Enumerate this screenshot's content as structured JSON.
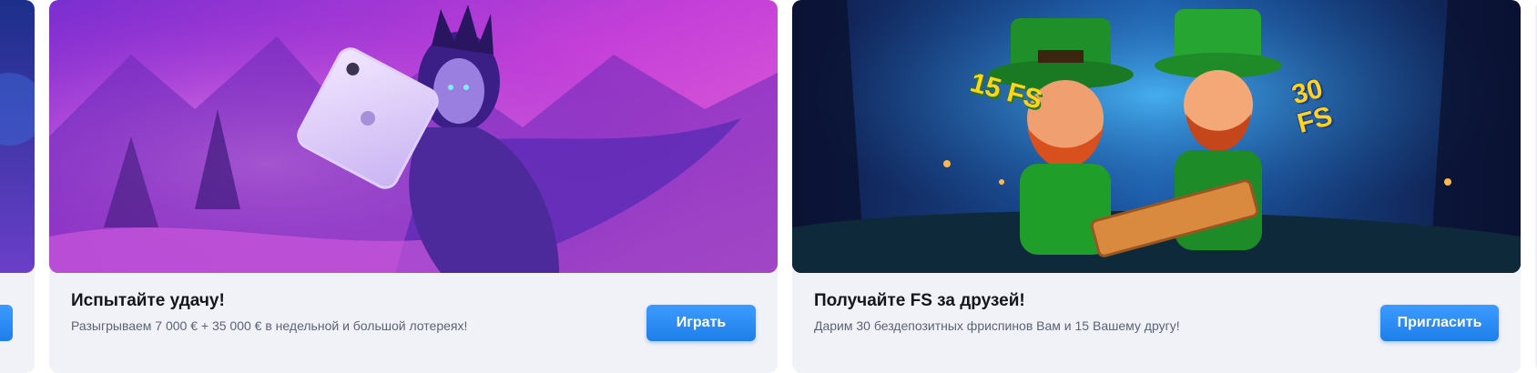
{
  "promos": [
    {
      "title": "Испытайте удачу!",
      "description": "Разыгрываем 7 000 € + 35 000 € в недельной и большой лотереях!",
      "button_label": "Играть",
      "image": "sorceress-with-tablet-illustration"
    },
    {
      "title": "Получайте FS за друзей!",
      "description": "Дарим 30 бездепозитных фриспинов Вам и 15 Вашему другу!",
      "button_label": "Пригласить",
      "image": "leprechauns-illustration",
      "badge_left": "15 FS",
      "badge_right": "30 FS"
    }
  ],
  "colors": {
    "button": "#2a8cf4",
    "card_bg": "#f0f2f7"
  }
}
